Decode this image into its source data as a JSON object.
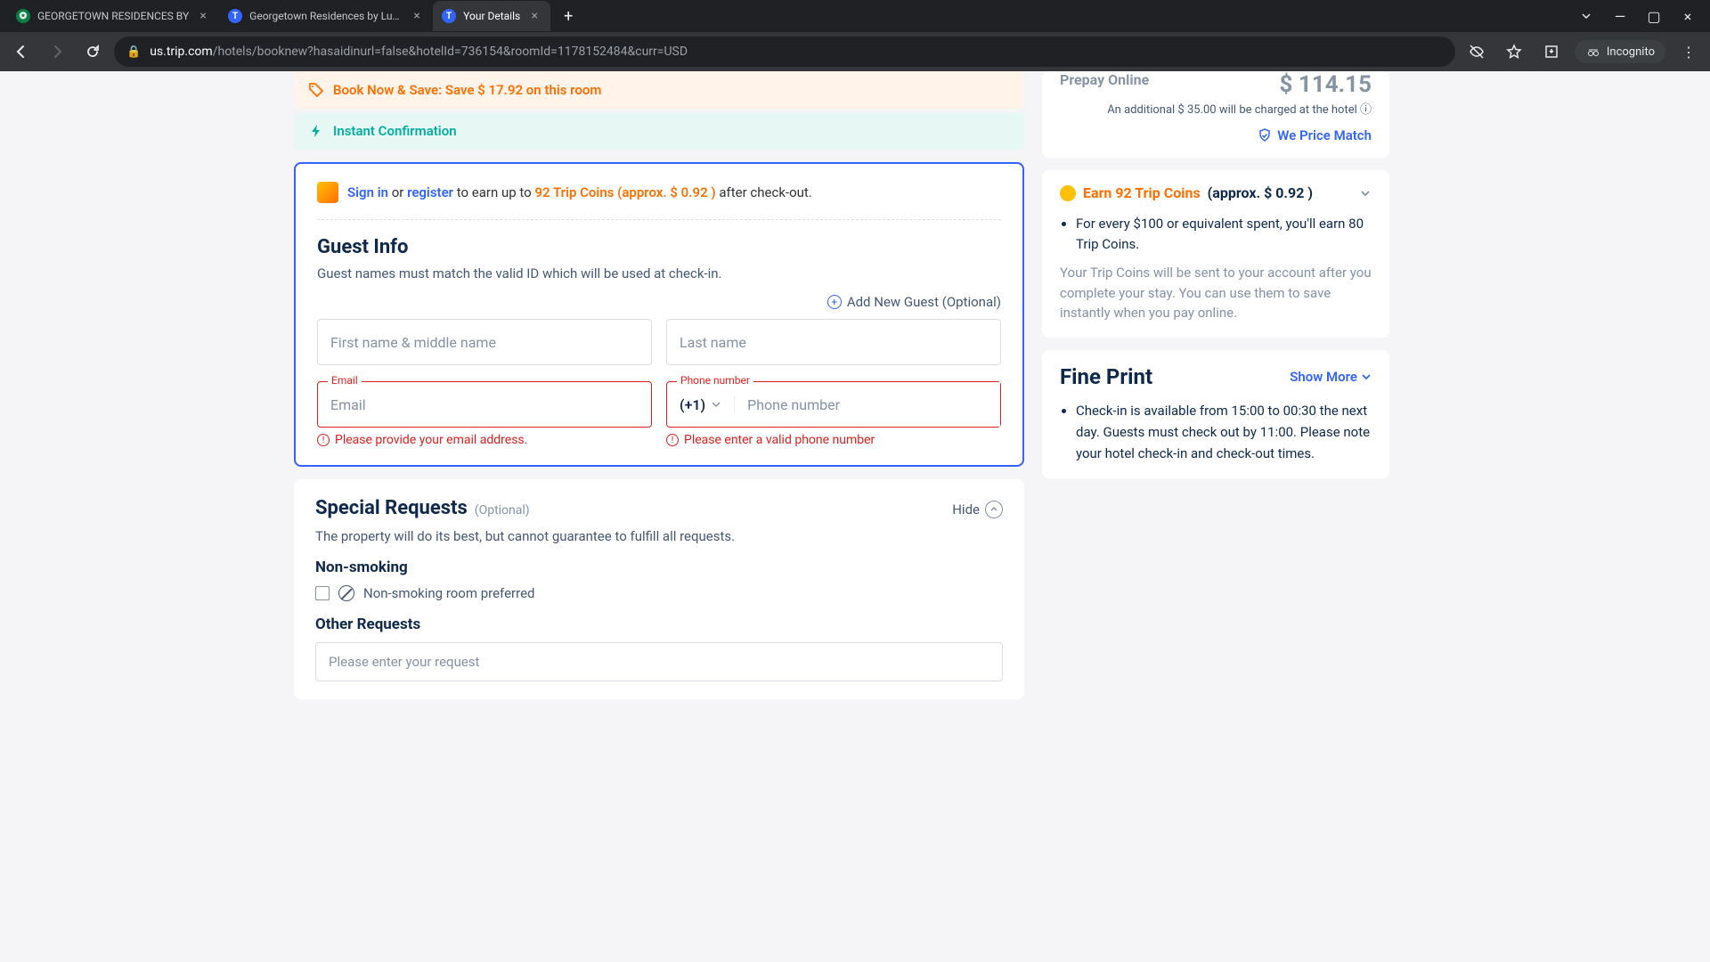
{
  "browser": {
    "tabs": [
      {
        "title": "GEORGETOWN RESIDENCES BY",
        "favicon": "green"
      },
      {
        "title": "Georgetown Residences by Luxu",
        "favicon": "blue"
      },
      {
        "title": "Your Details",
        "favicon": "blue",
        "active": true
      }
    ],
    "url_domain": "us.trip.com",
    "url_path": "/hotels/booknew?hasaidinurl=false&hotelId=736154&roomId=1178152484&curr=USD",
    "incognito": "Incognito"
  },
  "banners": {
    "save": "Book Now & Save: Save $ 17.92 on this room",
    "instant": "Instant Confirmation"
  },
  "signin": {
    "signin": "Sign in",
    "or": " or ",
    "register": "register",
    "mid": " to earn up to ",
    "coins": "92 Trip Coins (approx. $ 0.92 )",
    "after": " after check-out."
  },
  "guest": {
    "title": "Guest Info",
    "sub": "Guest names must match the valid ID which will be used at check-in.",
    "add_new": "Add New Guest (Optional)",
    "first_ph": "First name & middle name",
    "last_ph": "Last name",
    "email_label": "Email",
    "email_ph": "Email",
    "email_err": "Please provide your email address.",
    "phone_label": "Phone number",
    "phone_code": "(+1)",
    "phone_ph": "Phone number",
    "phone_err": "Please enter a valid phone number"
  },
  "special": {
    "title": "Special Requests",
    "optional": "(Optional)",
    "hide": "Hide",
    "sub": "The property will do its best, but cannot guarantee to fulfill all requests.",
    "nonsmoking_h": "Non-smoking",
    "nonsmoking_opt": "Non-smoking room preferred",
    "other_h": "Other Requests",
    "other_ph": "Please enter your request"
  },
  "sidebar": {
    "prepay_label": "Prepay Online",
    "prepay_price": "$ 114.15",
    "prepay_note": "An additional $ 35.00 will be charged at the hotel ⓘ",
    "price_match": "We Price Match",
    "coins_title": "Earn 92 Trip Coins",
    "coins_approx": "(approx. $ 0.92 )",
    "coins_bullet": "For every $100 or equivalent spent, you'll earn 80 Trip Coins.",
    "coins_note": "Your Trip Coins will be sent to your account after you complete your stay. You can use them to save instantly when you pay online.",
    "fp_title": "Fine Print",
    "show_more": "Show More",
    "fp_bullet": "Check-in is available from 15:00 to 00:30 the next day. Guests must check out by 11:00. Please note your hotel check-in and check-out times."
  }
}
